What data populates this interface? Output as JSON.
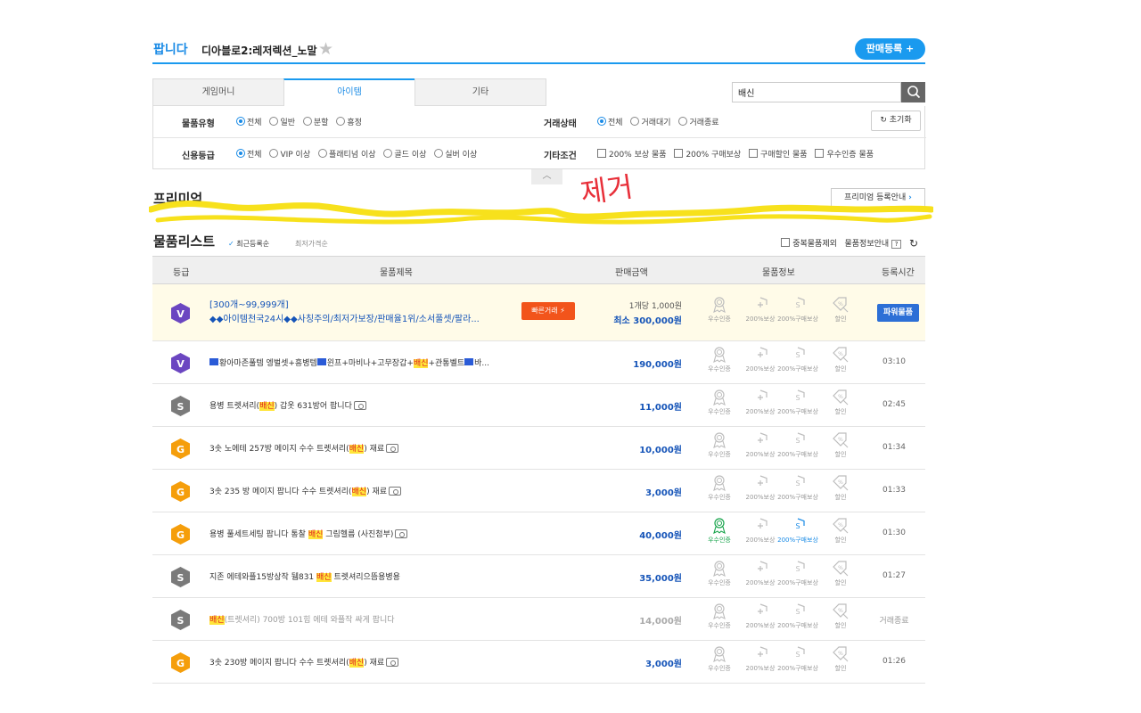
{
  "header": {
    "title": "팝니다",
    "subtitle": "디아블로2:레저렉션_노말",
    "sell_button": "판매등록 +"
  },
  "tabs": [
    {
      "label": "게임머니",
      "active": false
    },
    {
      "label": "아이템",
      "active": true
    },
    {
      "label": "기타",
      "active": false
    }
  ],
  "search": {
    "value": "배신"
  },
  "filters": {
    "item_type": {
      "label": "물품유형",
      "options": [
        "전체",
        "일반",
        "분할",
        "흥정"
      ],
      "selected": "전체"
    },
    "trade_status": {
      "label": "거래상태",
      "options": [
        "전체",
        "거래대기",
        "거래종료"
      ],
      "selected": "전체"
    },
    "reset": "초기화",
    "credit": {
      "label": "신용등급",
      "options": [
        "전체",
        "VIP 이상",
        "플래티넘 이상",
        "골드 이상",
        "실버 이상"
      ],
      "selected": "전체"
    },
    "etc": {
      "label": "기타조건",
      "options": [
        "200% 보상 물품",
        "200% 구매보상",
        "구매할인 물품",
        "우수인증 물품"
      ]
    }
  },
  "premium": {
    "title": "프리미엄",
    "guide_button": "프리미엄 등록안내",
    "annotation": "제거"
  },
  "list": {
    "title": "물품리스트",
    "sort_recent": "최근등록순",
    "sort_price": "최저가격순",
    "exclude_dup": "중복물품제외",
    "info_guide": "물품정보안내",
    "columns": [
      "등급",
      "물품제목",
      "판매금액",
      "물품정보",
      "등록시간"
    ],
    "badge_labels": [
      "우수인증",
      "200%보상",
      "200%구매보상",
      "할인"
    ]
  },
  "rows": [
    {
      "grade": "V",
      "grade_color": "#6b46c1",
      "title_line1": "[300개~99,999개]",
      "title_line2": "◆◆아이템천국24시◆◆사칭주의/최저가보장/판매율1위/소서풀셋/팔라...",
      "fast": "빠른거래",
      "price_unit": "1개당 1,000원",
      "price": "최소 300,000원",
      "time": "",
      "power": "파워물품",
      "active_badges": []
    },
    {
      "grade": "V",
      "grade_color": "#6b46c1",
      "title_pre": "황아마존풀템 엥벌셋+흥병템",
      "title_mid": "윈프+마비나+고무장갑+",
      "title_hl": "배신",
      "title_post": "+관통벨트",
      "title_end": "바...",
      "price": "190,000원",
      "time": "03:10",
      "active_badges": []
    },
    {
      "grade": "S",
      "grade_color": "#7a7a7a",
      "title_pre": "용병 트렛셔리(",
      "title_hl": "배신",
      "title_post": ") 갑옷 631방어 팝니다",
      "camera": true,
      "price": "11,000원",
      "time": "02:45",
      "active_badges": []
    },
    {
      "grade": "G",
      "grade_color": "#f59e0b",
      "title_pre": "3솟 노에테 257방 메이지 수수 트렛셔리(",
      "title_hl": "배신",
      "title_post": ") 재료",
      "camera": true,
      "price": "10,000원",
      "time": "01:34",
      "active_badges": []
    },
    {
      "grade": "G",
      "grade_color": "#f59e0b",
      "title_pre": "3솟 235 방 메이지 팝니다 수수 트렛셔리(",
      "title_hl": "배신",
      "title_post": ") 재료",
      "camera": true,
      "price": "3,000원",
      "time": "01:33",
      "active_badges": []
    },
    {
      "grade": "G",
      "grade_color": "#f59e0b",
      "title_pre": "용병 풀세트세팅 팝니다 통찰 ",
      "title_hl": "배신",
      "title_post": " 그림헬름 (사진첨부)",
      "camera": true,
      "price": "40,000원",
      "time": "01:30",
      "active_badges": [
        0,
        2
      ]
    },
    {
      "grade": "S",
      "grade_color": "#7a7a7a",
      "title_pre": "지존 에테와플15방상작 뒘831 ",
      "title_hl": "배신",
      "title_post": " 트렛셔리으뜸용병용",
      "camera": false,
      "price": "35,000원",
      "time": "01:27",
      "active_badges": []
    },
    {
      "grade": "S",
      "grade_color": "#7a7a7a",
      "title_pre": "",
      "title_hl": "배신",
      "title_post": "(트렛셔리) 700방 101힘 에테 와플작 싸게 팝니다",
      "camera": false,
      "dim": true,
      "price": "14,000원",
      "time": "거래종료",
      "active_badges": []
    },
    {
      "grade": "G",
      "grade_color": "#f59e0b",
      "title_pre": "3솟 230방 메이지 팝니다 수수 트렛셔리(",
      "title_hl": "배신",
      "title_post": ") 재료",
      "camera": true,
      "price": "3,000원",
      "time": "01:26",
      "active_badges": []
    }
  ]
}
